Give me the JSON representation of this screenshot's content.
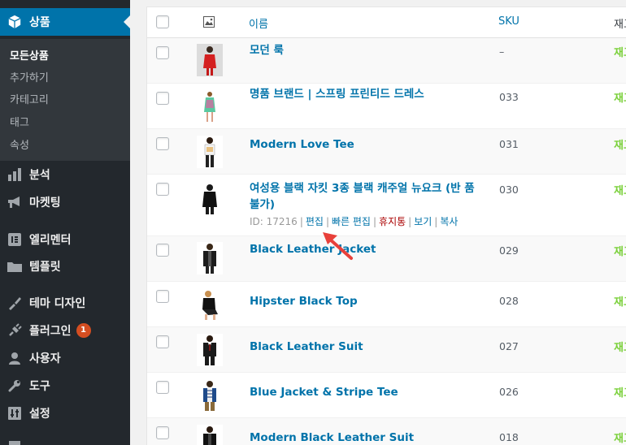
{
  "sidebar": {
    "active_menu": {
      "label": "상품",
      "icon": "box-icon"
    },
    "submenu": [
      "모든상품",
      "추가하기",
      "카테고리",
      "태그",
      "속성"
    ],
    "menus": [
      {
        "label": "분석",
        "icon": "bar-chart-icon"
      },
      {
        "label": "마켓팅",
        "icon": "megaphone-icon"
      },
      {
        "label": "엘리멘터",
        "icon": "elementor-icon"
      },
      {
        "label": "템플릿",
        "icon": "folder-icon"
      },
      {
        "label": "테마 디자인",
        "icon": "paintbrush-icon"
      },
      {
        "label": "플러그인",
        "icon": "plug-icon",
        "badge": "1"
      },
      {
        "label": "사용자",
        "icon": "user-icon"
      },
      {
        "label": "도구",
        "icon": "wrench-icon"
      },
      {
        "label": "설정",
        "icon": "settings-icon"
      }
    ]
  },
  "table": {
    "headers": {
      "name": "이름",
      "sku": "SKU",
      "stock": "재고"
    },
    "rows": [
      {
        "name": "모던 룩",
        "sku": "–",
        "stock": "재고"
      },
      {
        "name": "명품 브랜드 | 스프링 프린티드 드레스",
        "sku": "033",
        "stock": "재고"
      },
      {
        "name": "Modern Love Tee",
        "sku": "031",
        "stock": "재고"
      },
      {
        "name": "여성용 블랙 자킷 3종 블랙 캐주얼 뉴요크 (반 품 불가)",
        "sku": "030",
        "stock": "재고"
      },
      {
        "name": "Black Leather Jacket",
        "sku": "029",
        "stock": "재고"
      },
      {
        "name": "Hipster Black Top",
        "sku": "028",
        "stock": "재고"
      },
      {
        "name": "Black Leather Suit",
        "sku": "027",
        "stock": "재고"
      },
      {
        "name": "Blue Jacket & Stripe Tee",
        "sku": "026",
        "stock": "재고"
      },
      {
        "name": "Modern Black Leather Suit",
        "sku": "018",
        "stock": "재고"
      }
    ],
    "row_actions": {
      "id_text": "ID: 17216",
      "edit": "편집",
      "quick_edit": "빠른 편집",
      "trash": "휴지통",
      "view": "보기",
      "copy": "복사"
    }
  },
  "colors": {
    "sidebar_bg": "#23282d",
    "submenu_bg": "#32373c",
    "accent": "#0073aa",
    "stock_green": "#7ad03a",
    "trash_red": "#a00",
    "annotation_arrow": "#e8403a"
  }
}
